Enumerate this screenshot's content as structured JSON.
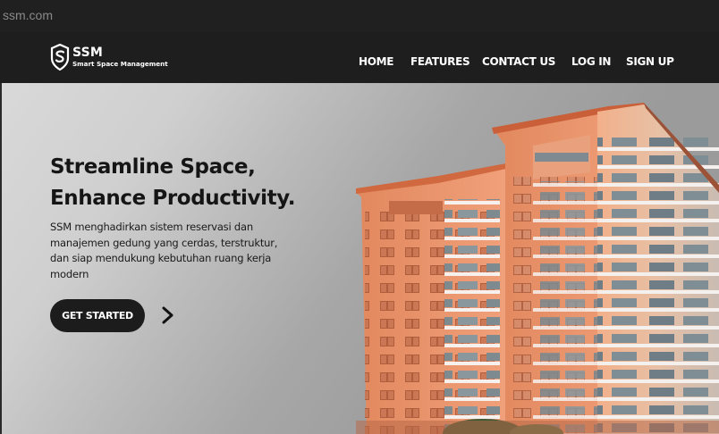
{
  "browser": {
    "url": "ssm.com"
  },
  "brand": {
    "abbr": "SSM",
    "name": "Smart Space Management",
    "logo_icon": "shield-s-logo"
  },
  "nav": {
    "items": [
      {
        "label": "HOME"
      },
      {
        "label": "FEATURES"
      },
      {
        "label": "CONTACT US"
      },
      {
        "label": "LOG IN"
      },
      {
        "label": "SIGN UP"
      }
    ]
  },
  "hero": {
    "headline_line1": "Streamline Space,",
    "headline_line2": "Enhance Productivity.",
    "description": "SSM menghadirkan sistem reservasi dan manajemen gedung yang cerdas, terstruktur, dan siap mendukung kebutuhan ruang kerja modern",
    "cta_label": "GET STARTED",
    "cta_arrow_icon": "chevron-right-icon",
    "image": "apartment-building-photo"
  },
  "colors": {
    "header_bg": "#1e1e1e",
    "accent_dark": "#1c1c1c",
    "building_orange": "#e07a4e"
  }
}
